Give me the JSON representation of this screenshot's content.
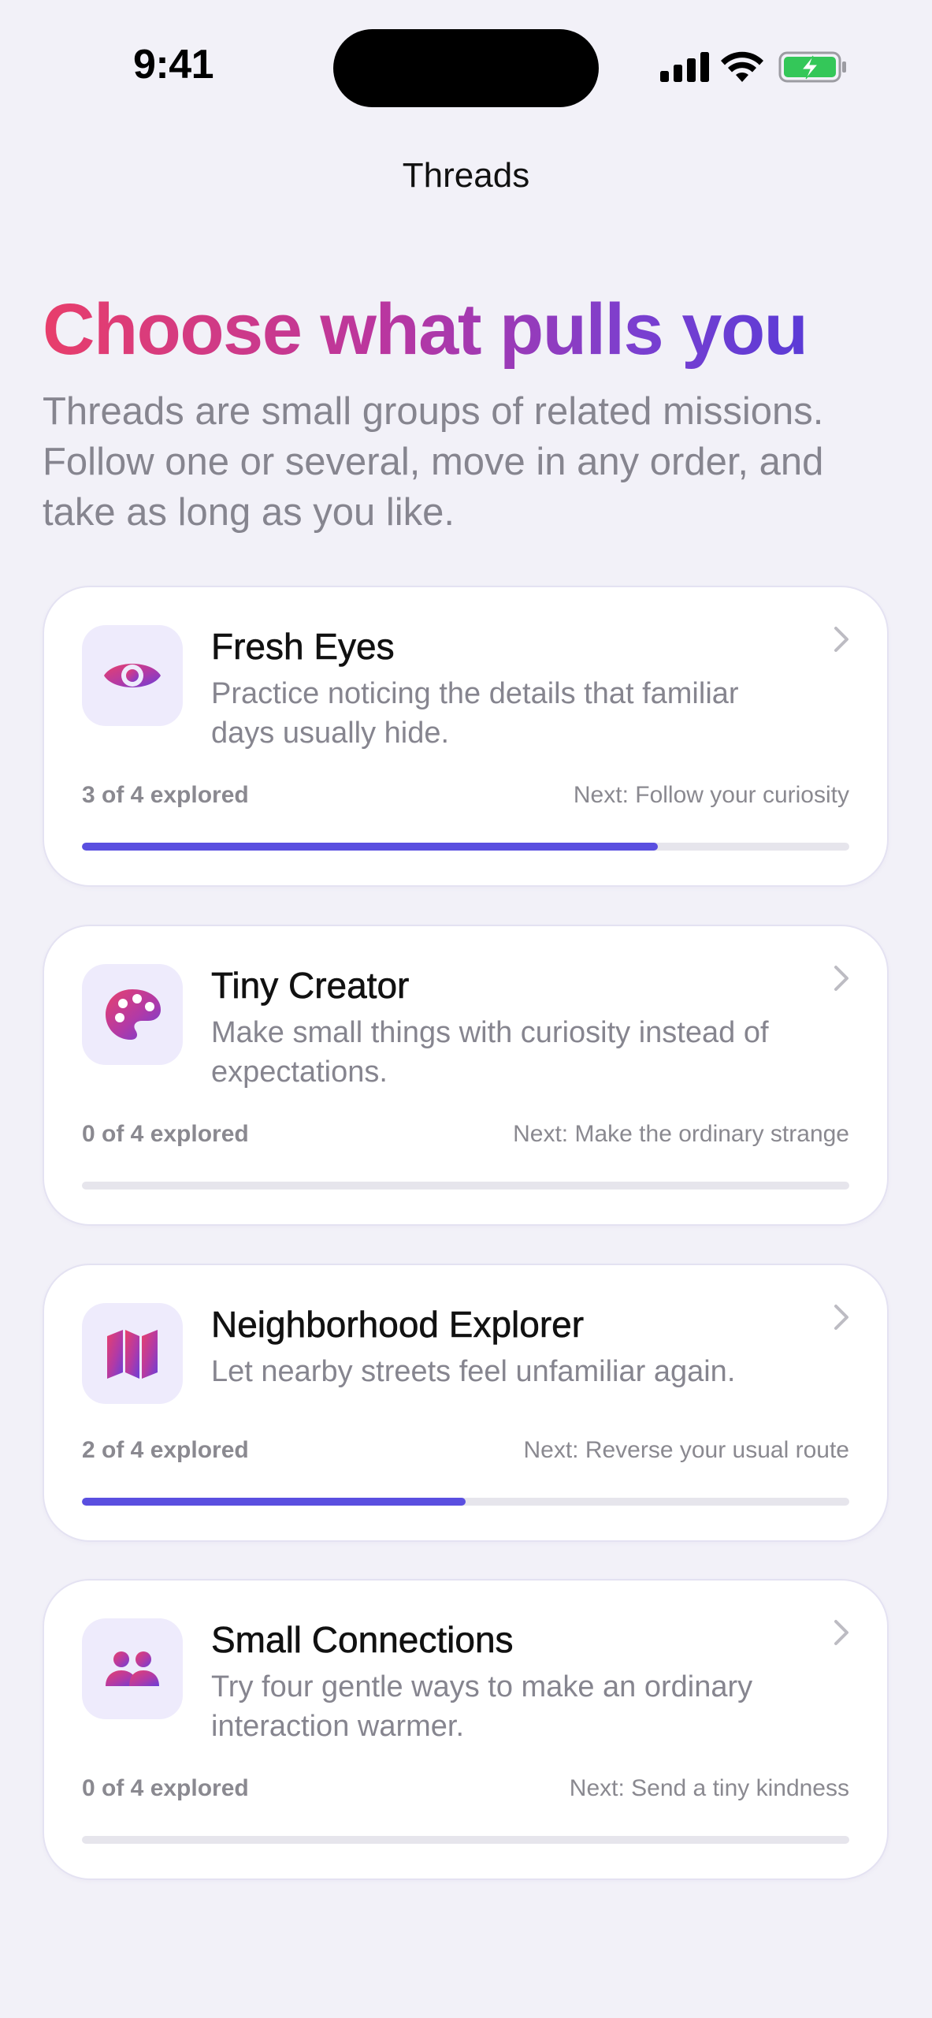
{
  "status_bar": {
    "time": "9:41",
    "icons": [
      "signal-icon",
      "wifi-icon",
      "battery-charging-icon"
    ]
  },
  "nav": {
    "title": "Threads"
  },
  "header": {
    "title": "Choose what pulls you",
    "subtitle": "Threads are small groups of related missions. Follow one or several, move in any order, and take as long as you like."
  },
  "colors": {
    "background": "#F2F1F8",
    "card": "#FFFFFF",
    "accent": "#5A4FE0",
    "title_gradient": [
      "#E83E6B",
      "#B936A0",
      "#5B3BD6"
    ],
    "muted_text": "#86858F"
  },
  "threads": [
    {
      "title": "Fresh Eyes",
      "description": "Practice noticing the details that familiar days usually hide.",
      "icon": "eye-icon",
      "progress_label": "3 of 4 explored",
      "explored": 3,
      "total": 4,
      "next": "Next: Follow your curiosity"
    },
    {
      "title": "Tiny Creator",
      "description": "Make small things with curiosity instead of expectations.",
      "icon": "palette-icon",
      "progress_label": "0 of 4 explored",
      "explored": 0,
      "total": 4,
      "next": "Next: Make the ordinary strange"
    },
    {
      "title": "Neighborhood Explorer",
      "description": "Let nearby streets feel unfamiliar again.",
      "icon": "map-icon",
      "progress_label": "2 of 4 explored",
      "explored": 2,
      "total": 4,
      "next": "Next: Reverse your usual route"
    },
    {
      "title": "Small Connections",
      "description": "Try four gentle ways to make an ordinary interaction warmer.",
      "icon": "people-icon",
      "progress_label": "0 of 4 explored",
      "explored": 0,
      "total": 4,
      "next": "Next: Send a tiny kindness"
    }
  ]
}
